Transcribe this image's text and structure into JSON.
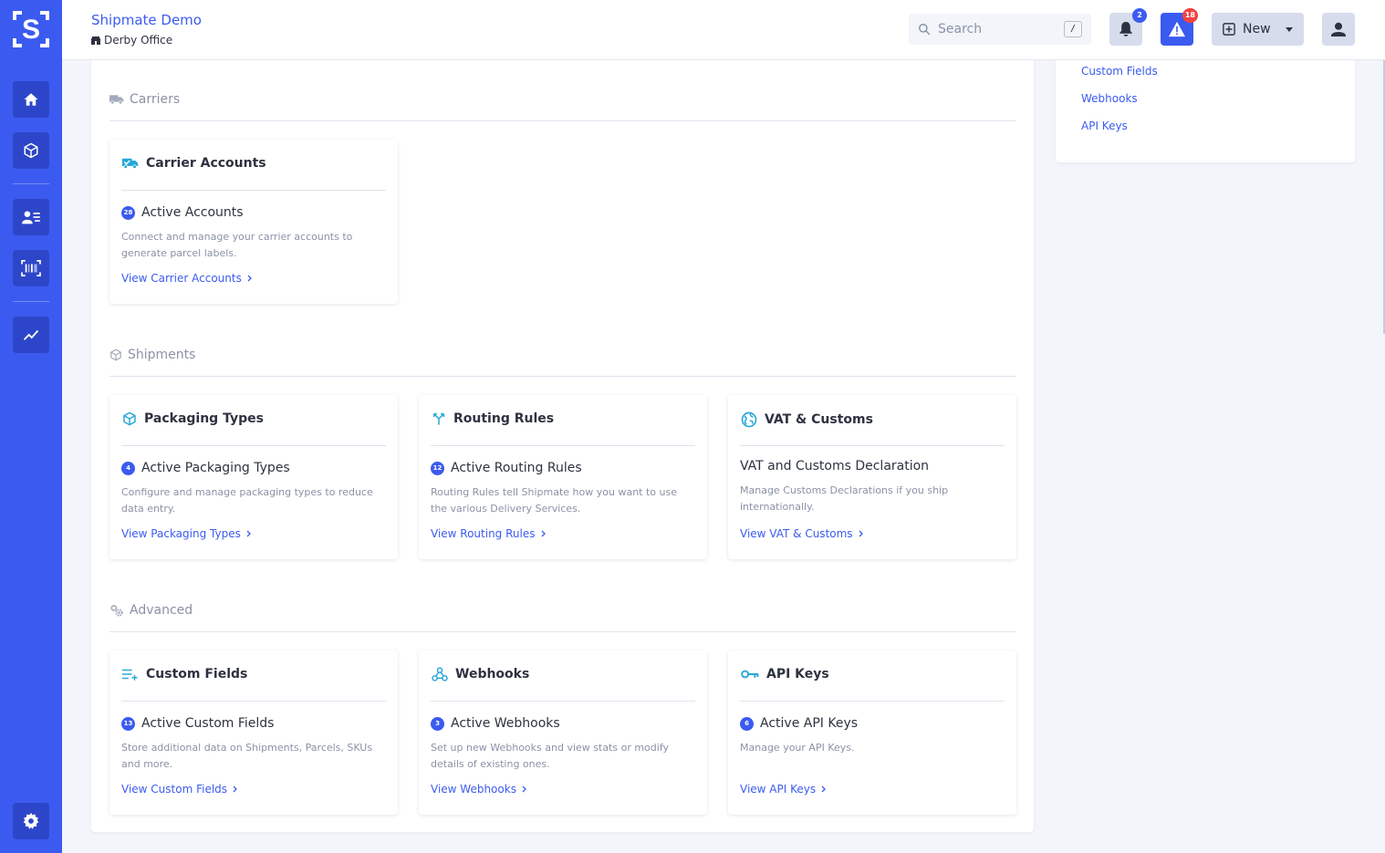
{
  "header": {
    "org_name": "Shipmate Demo",
    "org_location": "Derby Office",
    "search_placeholder": "Search",
    "search_shortcut": "/",
    "notifications_count": "2",
    "alerts_count": "18",
    "new_label": "New"
  },
  "right_panel": {
    "links": [
      "Custom Fields",
      "Webhooks",
      "API Keys"
    ]
  },
  "sections": [
    {
      "title": "Carriers",
      "icon": "truck-icon",
      "cards": [
        {
          "title": "Carrier Accounts",
          "icon": "truck-check-icon",
          "count": "28",
          "stat": "Active Accounts",
          "desc": "Connect and manage your carrier accounts to generate parcel labels.",
          "link": "View Carrier Accounts"
        }
      ]
    },
    {
      "title": "Shipments",
      "icon": "box-icon",
      "cards": [
        {
          "title": "Packaging Types",
          "icon": "box-icon",
          "count": "4",
          "stat": "Active Packaging Types",
          "desc": "Configure and manage packaging types to reduce data entry.",
          "link": "View Packaging Types"
        },
        {
          "title": "Routing Rules",
          "icon": "routing-icon",
          "count": "12",
          "stat": "Active Routing Rules",
          "desc": "Routing Rules tell Shipmate how you want to use the various Delivery Services.",
          "link": "View Routing Rules"
        },
        {
          "title": "VAT & Customs",
          "icon": "globe-icon",
          "count": "",
          "stat": "VAT and Customs Declaration",
          "desc": "Manage Customs Declarations if you ship internationally.",
          "link": "View VAT & Customs"
        }
      ]
    },
    {
      "title": "Advanced",
      "icon": "gears-icon",
      "cards": [
        {
          "title": "Custom Fields",
          "icon": "list-plus-icon",
          "count": "13",
          "stat": "Active Custom Fields",
          "desc": "Store additional data on Shipments, Parcels, SKUs and more.",
          "link": "View Custom Fields"
        },
        {
          "title": "Webhooks",
          "icon": "webhook-icon",
          "count": "3",
          "stat": "Active Webhooks",
          "desc": "Set up new Webhooks and view stats or modify details of existing ones.",
          "link": "View Webhooks"
        },
        {
          "title": "API Keys",
          "icon": "key-icon",
          "count": "6",
          "stat": "Active API Keys",
          "desc": "Manage your API Keys.",
          "link": "View API Keys"
        }
      ]
    }
  ],
  "colors": {
    "brand": "#3b5bf0",
    "sidebar_button": "#2d46c9",
    "alert": "#f04444",
    "accent_icon": "#28a7d9"
  }
}
